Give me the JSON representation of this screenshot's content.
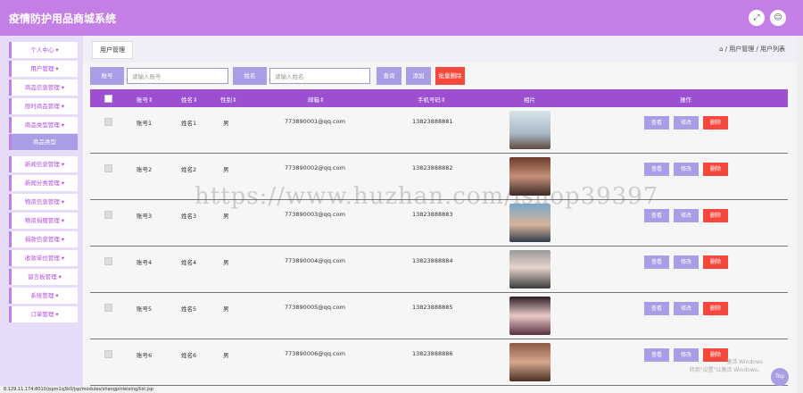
{
  "header": {
    "title": "疫情防护用品商城系统",
    "fullscreen_icon": "expand-icon",
    "user_icon": "user-icon"
  },
  "sidebar": {
    "items": [
      {
        "label": "个人中心 ▾"
      },
      {
        "label": "用户管理 ▾"
      },
      {
        "label": "商品信息管理 ▾"
      },
      {
        "label": "限时商品管理 ▾"
      },
      {
        "label": "商品类型管理 ▾"
      },
      {
        "label": "商品类型",
        "active": true
      },
      {
        "label": "新闻信息管理 ▾"
      },
      {
        "label": "新闻分类管理 ▾"
      },
      {
        "label": "物资信息管理 ▾"
      },
      {
        "label": "物资捐赠管理 ▾"
      },
      {
        "label": "捐款信息管理 ▾"
      },
      {
        "label": "收款单位管理 ▾"
      },
      {
        "label": "留言板管理 ▾"
      },
      {
        "label": "系统管理 ▾"
      },
      {
        "label": "订单管理 ▾"
      }
    ]
  },
  "breadcrumb": {
    "tab": "用户管理",
    "path": "⌂ / 用户管理 / 用户列表"
  },
  "search": {
    "account_label": "账号",
    "account_placeholder": "请输入账号",
    "name_label": "姓名",
    "name_placeholder": "请输入姓名",
    "query": "查询",
    "add": "添加",
    "batch_delete": "批量删除"
  },
  "table": {
    "headers": [
      "账号⇕",
      "姓名⇕",
      "性别⇕",
      "邮箱⇕",
      "手机号码⇕",
      "相片",
      "操作"
    ],
    "rows": [
      {
        "account": "账号1",
        "name": "姓名1",
        "gender": "男",
        "email": "773890001@qq.com",
        "phone": "13823888881"
      },
      {
        "account": "账号2",
        "name": "姓名2",
        "gender": "男",
        "email": "773890002@qq.com",
        "phone": "13823888882"
      },
      {
        "account": "账号3",
        "name": "姓名3",
        "gender": "男",
        "email": "773890003@qq.com",
        "phone": "13823888883"
      },
      {
        "account": "账号4",
        "name": "姓名4",
        "gender": "男",
        "email": "773890004@qq.com",
        "phone": "13823888884"
      },
      {
        "account": "账号5",
        "name": "姓名5",
        "gender": "男",
        "email": "773890005@qq.com",
        "phone": "13823888885"
      },
      {
        "account": "账号6",
        "name": "姓名6",
        "gender": "男",
        "email": "773890006@qq.com",
        "phone": "13823888886"
      }
    ],
    "actions": {
      "view": "查看",
      "edit": "修改",
      "delete": "删除"
    }
  },
  "overlay": {
    "watermark": "https://www.huzhan.com/ishop39397",
    "windows_line1": "激活 Windows",
    "windows_line2": "转到\"设置\"以激活 Windows。",
    "top_button": "Top",
    "status_url": "8.129.11.174:8010/jspm1q3k0/jsp/modules/shangpinleixing/list.jsp"
  },
  "colors": {
    "accent": "#c47fe6",
    "header": "#9c4fd1",
    "button": "#a99de6",
    "danger": "#f4483c"
  }
}
